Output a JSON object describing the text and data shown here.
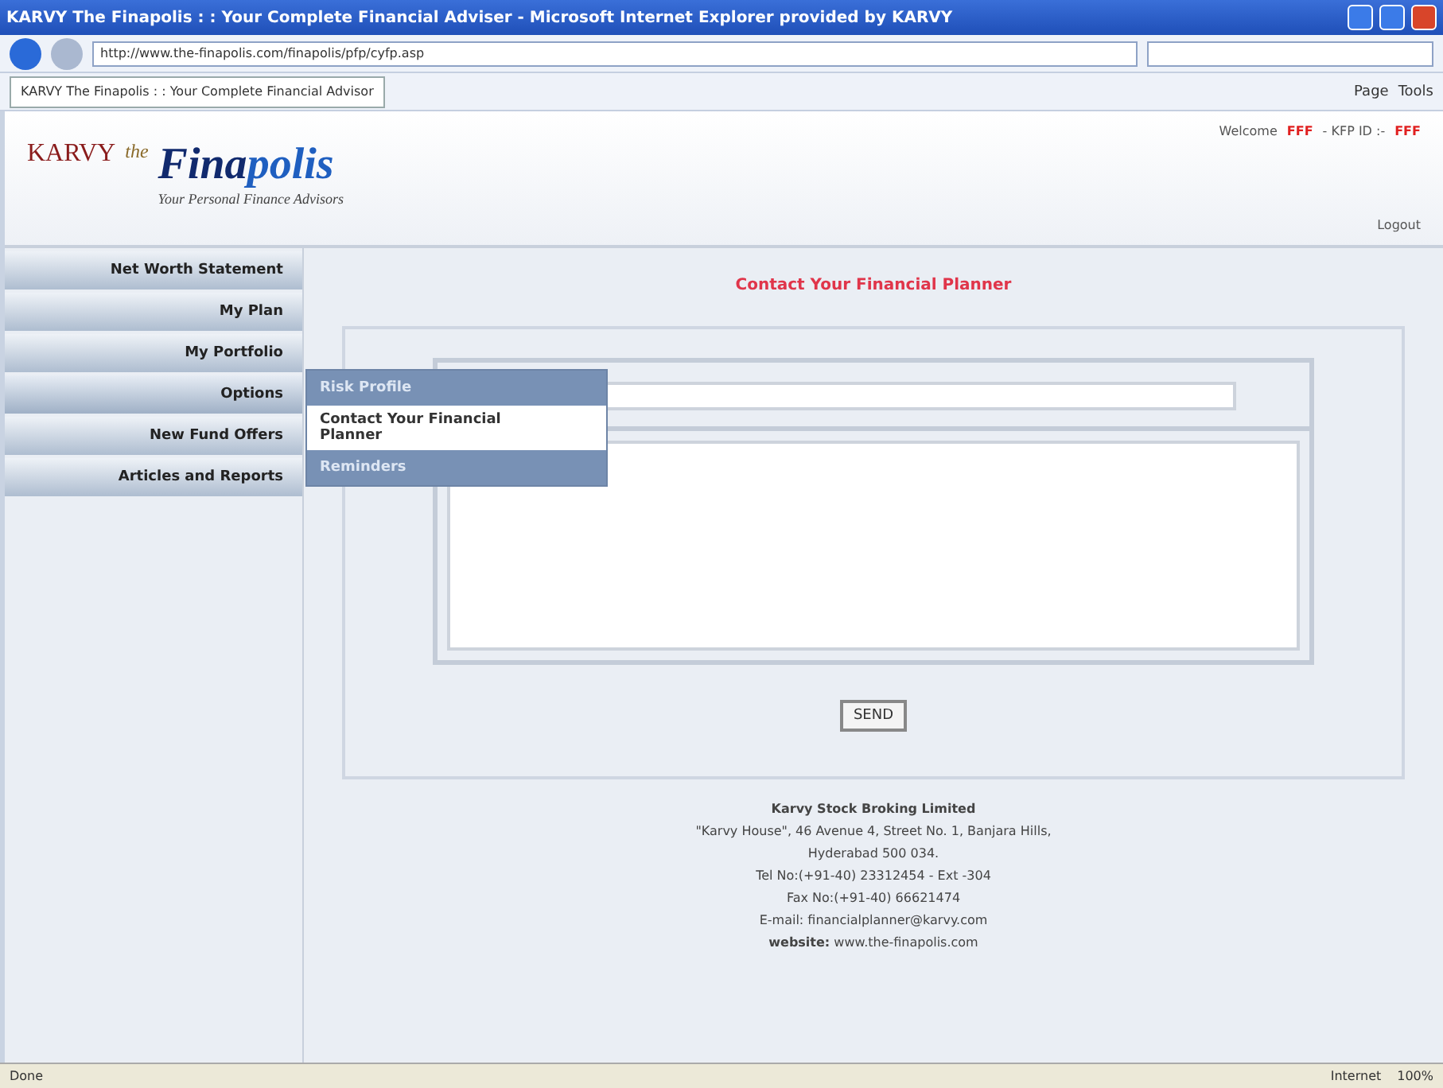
{
  "window": {
    "title": "KARVY The Finapolis : : Your Complete Financial Adviser - Microsoft Internet Explorer provided by KARVY"
  },
  "address_bar": {
    "url": "http://www.the-finapolis.com/finapolis/pfp/cyfp.asp"
  },
  "tab": {
    "label": "KARVY The Finapolis : : Your Complete Financial Advisor"
  },
  "toolbar": {
    "buttons": [
      "Page",
      "Tools"
    ]
  },
  "header": {
    "logo_brand": "KARVY",
    "logo_prefix": "the",
    "logo_first": "Fina",
    "logo_second": "polis",
    "tagline": "Your Personal Finance Advisors",
    "welcome": "Welcome",
    "user": "FFF",
    "id_label": "- KFP ID :-",
    "user_id": "FFF",
    "logout": "Logout"
  },
  "sidebar": {
    "items": [
      {
        "label": "Net Worth Statement",
        "selected": false
      },
      {
        "label": "My Plan",
        "selected": false
      },
      {
        "label": "My Portfolio",
        "selected": false
      },
      {
        "label": "Options",
        "selected": true
      },
      {
        "label": "New Fund Offers",
        "selected": false
      },
      {
        "label": "Articles and Reports",
        "selected": false
      }
    ]
  },
  "submenu": {
    "items": [
      {
        "label": "Risk Profile",
        "selected": false
      },
      {
        "label": "Contact Your Financial Planner",
        "selected": true
      },
      {
        "label": "Reminders",
        "selected": false
      }
    ]
  },
  "main": {
    "title": "Contact Your Financial Planner",
    "send_button": "SEND"
  },
  "footer": {
    "company": "Karvy Stock Broking Limited",
    "lines": [
      "\"Karvy House\", 46 Avenue 4, Street No. 1, Banjara Hills,",
      "Hyderabad 500 034.",
      "Tel No:(+91-40) 23312454 - Ext -304",
      "Fax No:(+91-40) 66621474",
      "E-mail:  financialplanner@karvy.com"
    ],
    "website_label": "website:",
    "website": "www.the-finapolis.com"
  },
  "status_bar": {
    "text": "Done",
    "zone": "Internet",
    "zoom": "100%"
  }
}
